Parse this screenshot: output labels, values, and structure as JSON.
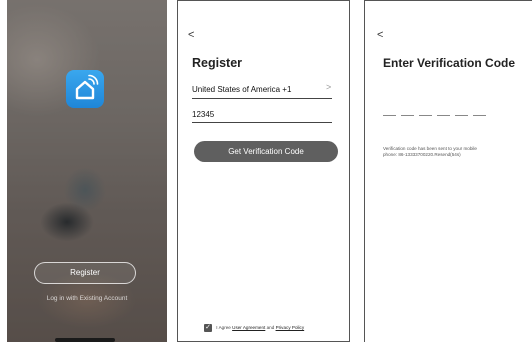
{
  "screen1": {
    "app_icon": "home-wifi-icon",
    "register_label": "Register",
    "login_label": "Log in with Existing Account"
  },
  "screen2": {
    "back_glyph": "<",
    "title": "Register",
    "country_value": "United States of America +1",
    "country_chevron": ">",
    "phone_value": "12345",
    "button_label": "Get Verification Code",
    "agree_prefix": "I Agree",
    "user_agreement": "User Agreement",
    "and_text": "and",
    "privacy_policy": "Privacy Policy"
  },
  "screen3": {
    "back_glyph": "<",
    "title": "Enter Verification Code",
    "code_slots": 6,
    "sent_line1": "Verification code has been sent to your mobile",
    "sent_line2": "phone: 86-13333700220.Resend(54s)"
  },
  "colors": {
    "button_gray": "#5f5f5f",
    "app_icon_blue": "#2b98e6"
  }
}
